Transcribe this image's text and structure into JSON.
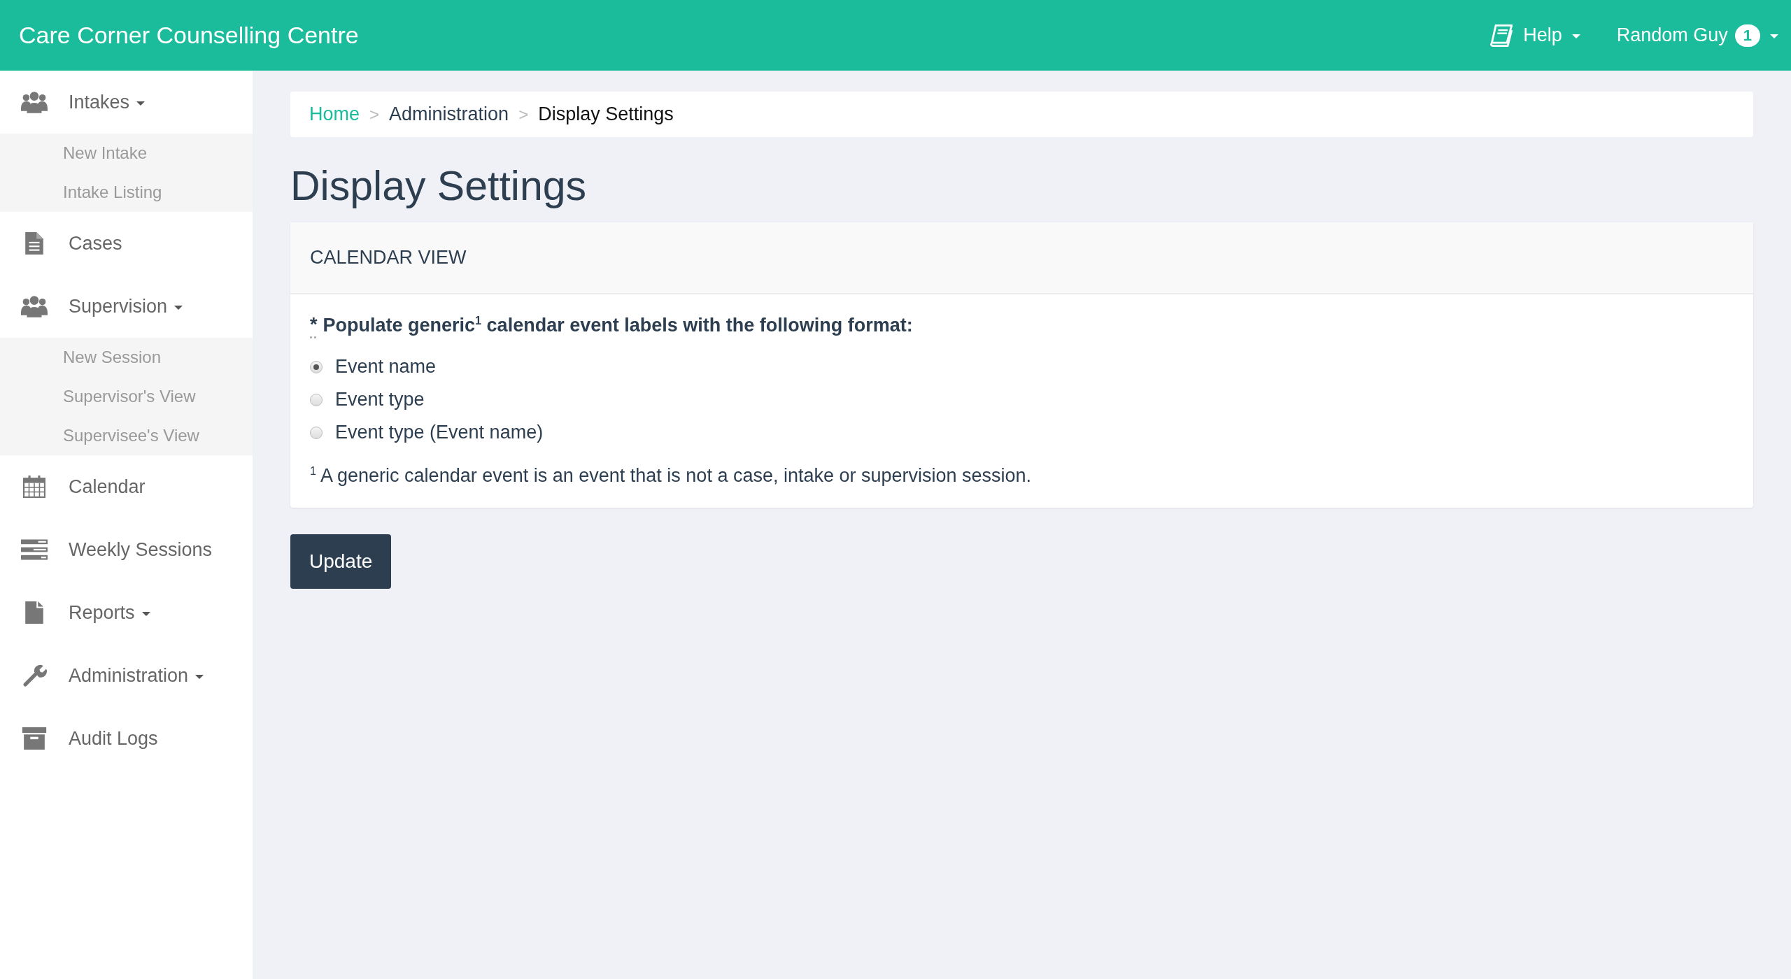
{
  "navbar": {
    "brand": "Care Corner Counselling Centre",
    "menus": [
      {
        "kind": "help",
        "label": "Help",
        "dropdown": true
      },
      {
        "kind": "user",
        "label": "Random Guy",
        "badge": "1",
        "dropdown": true
      }
    ]
  },
  "sidebar": {
    "items": [
      {
        "label": "Intakes",
        "dropdown": true,
        "children": [
          {
            "label": "New Intake"
          },
          {
            "label": "Intake Listing"
          }
        ]
      },
      {
        "label": "Cases",
        "dropdown": false
      },
      {
        "label": "Supervision",
        "dropdown": true,
        "children": [
          {
            "label": "New Session"
          },
          {
            "label": "Supervisor's View"
          },
          {
            "label": "Supervisee's View"
          }
        ]
      },
      {
        "label": "Calendar",
        "dropdown": false
      },
      {
        "label": "Weekly Sessions",
        "dropdown": false
      },
      {
        "label": "Reports",
        "dropdown": true
      },
      {
        "label": "Administration",
        "dropdown": true
      },
      {
        "label": "Audit Logs",
        "dropdown": false
      }
    ]
  },
  "breadcrumb": [
    {
      "label": "Home",
      "kind": "link"
    },
    {
      "label": "Administration",
      "kind": "text"
    },
    {
      "label": "Display Settings",
      "kind": "current"
    }
  ],
  "breadcrumb_separator": ">",
  "page_title": "Display Settings",
  "panel": {
    "heading": "CALENDAR VIEW",
    "required_mark": "*",
    "question": "Populate generic$^{1}$ calendar event labels with the following format:",
    "options": [
      {
        "label": "Event name",
        "selected": true
      },
      {
        "label": "Event type",
        "selected": false
      },
      {
        "label": "Event type (Event name)",
        "selected": false
      }
    ],
    "footnote": "$^{1}$ A generic calendar event is an event that is not a case, intake or supervision session."
  },
  "submit_button": "Update"
}
